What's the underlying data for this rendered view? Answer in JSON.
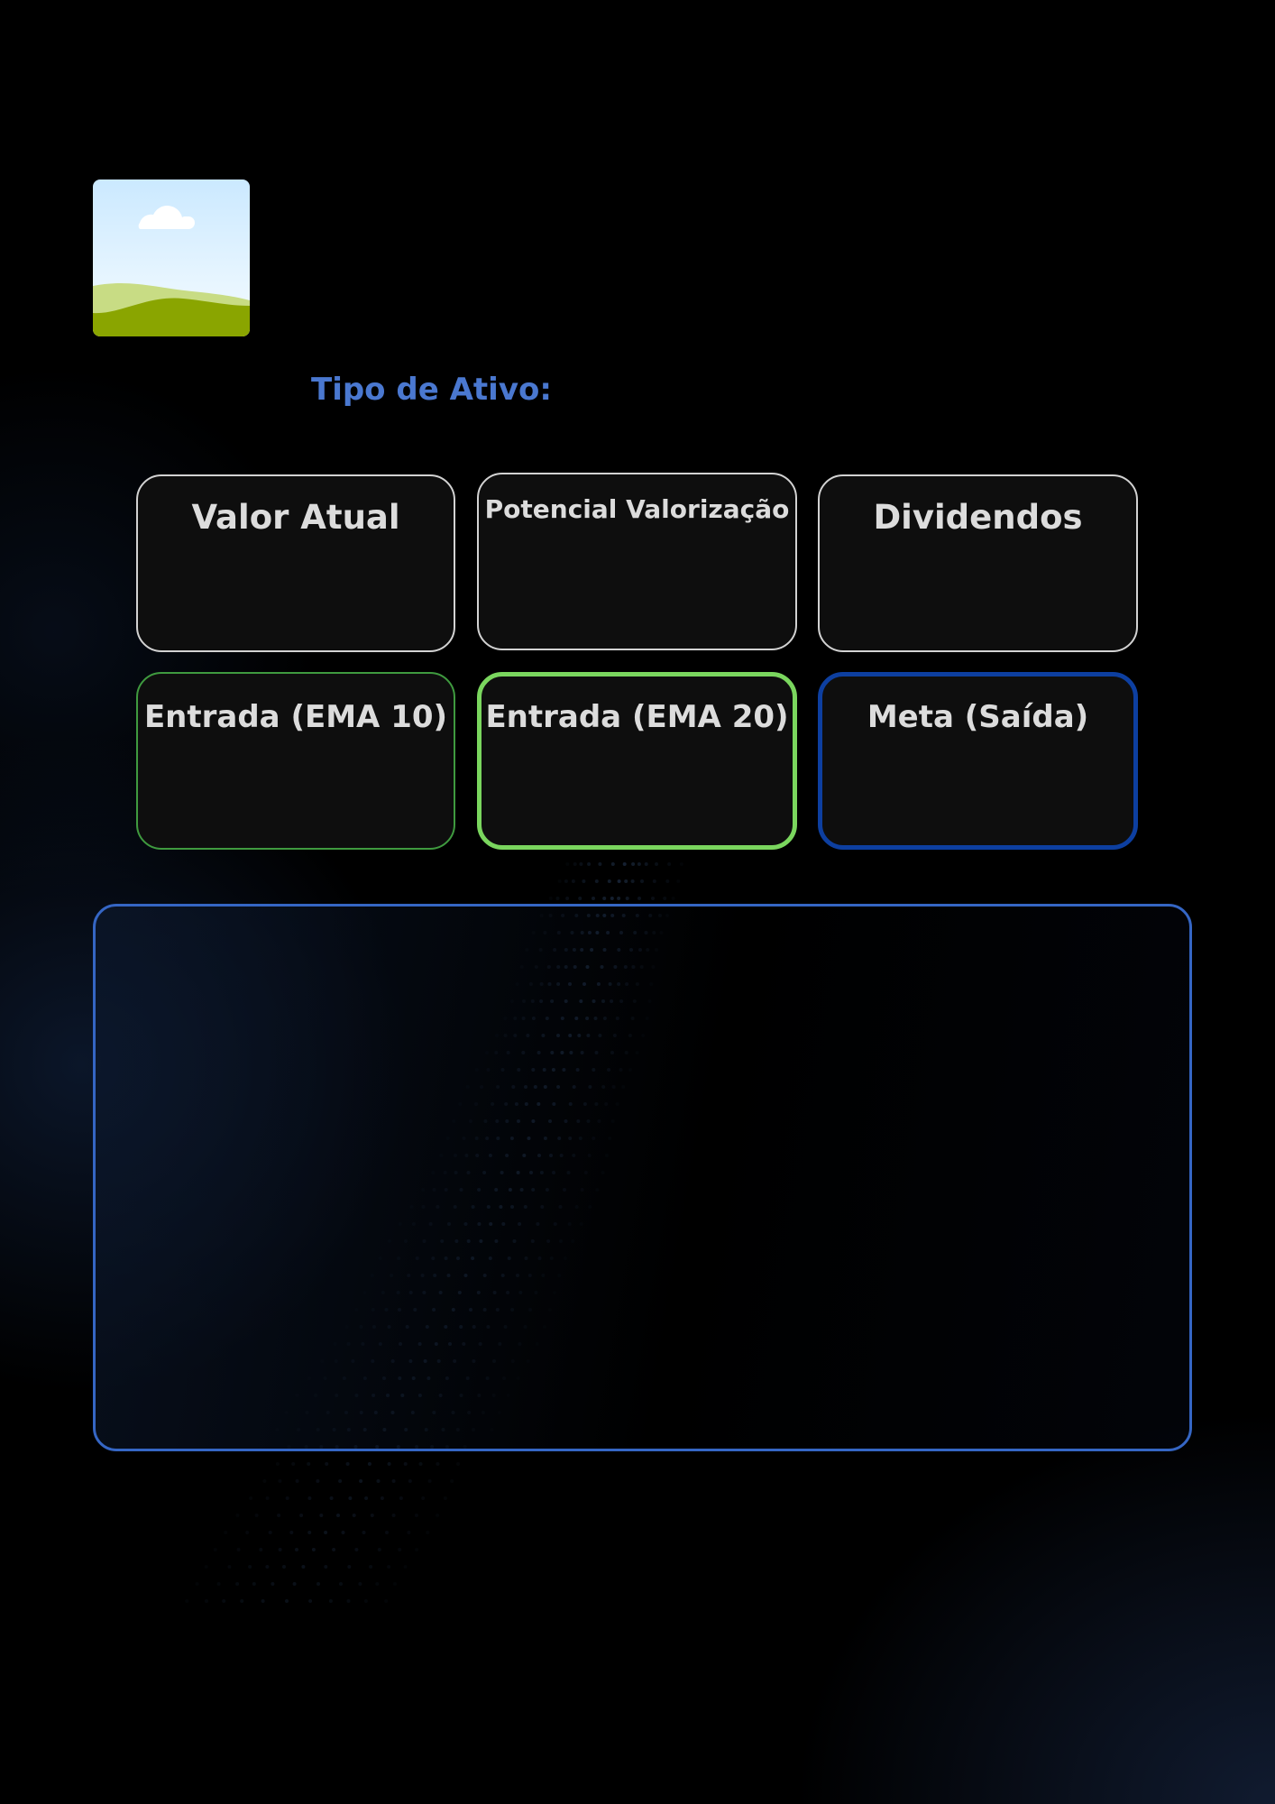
{
  "header": {
    "asset_type_label": "Tipo de Ativo:"
  },
  "logo": {
    "icon": "landscape-image-placeholder-icon"
  },
  "cards": {
    "valor_atual": "Valor Atual",
    "potencial_valorizacao": "Potencial Valorização",
    "dividendos": "Dividendos",
    "entrada_ema10": "Entrada (EMA 10)",
    "entrada_ema20": "Entrada (EMA 20)",
    "meta_saida": "Meta (Saída)"
  },
  "colors": {
    "accent_blue": "#4a78d0",
    "panel_border": "#3566c4",
    "ema10_border": "#3f9a3f",
    "ema20_border": "#7ad65e",
    "meta_border": "#0d3fa0",
    "card_background": "#0e0e0e"
  }
}
